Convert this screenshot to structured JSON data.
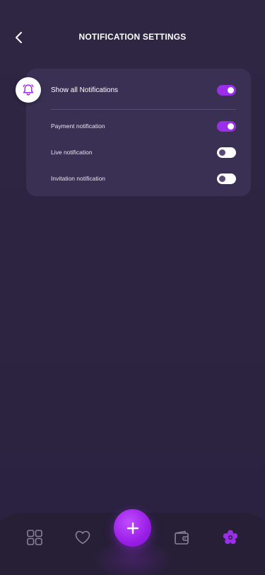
{
  "header": {
    "title": "NOTIFICATION SETTINGS",
    "back_icon": "chevron-left-icon"
  },
  "notifications": {
    "icon": "bell-icon",
    "master": {
      "label": "Show all Notifications",
      "enabled": true
    },
    "items": [
      {
        "label": "Payment notification",
        "enabled": true
      },
      {
        "label": "Live notification",
        "enabled": false
      },
      {
        "label": "Invitation notification",
        "enabled": false
      }
    ]
  },
  "bottom_nav": {
    "items": [
      {
        "icon": "grid-icon",
        "active": false
      },
      {
        "icon": "heart-icon",
        "active": false
      },
      {
        "icon": "plus-icon",
        "active": false
      },
      {
        "icon": "wallet-icon",
        "active": false
      },
      {
        "icon": "flower-settings-icon",
        "active": true
      }
    ]
  },
  "colors": {
    "accent": "#9b2ee8",
    "background": "#2c2440",
    "card": "#3a3053",
    "nav_background": "#261f36",
    "icon_inactive": "#8a8199"
  }
}
